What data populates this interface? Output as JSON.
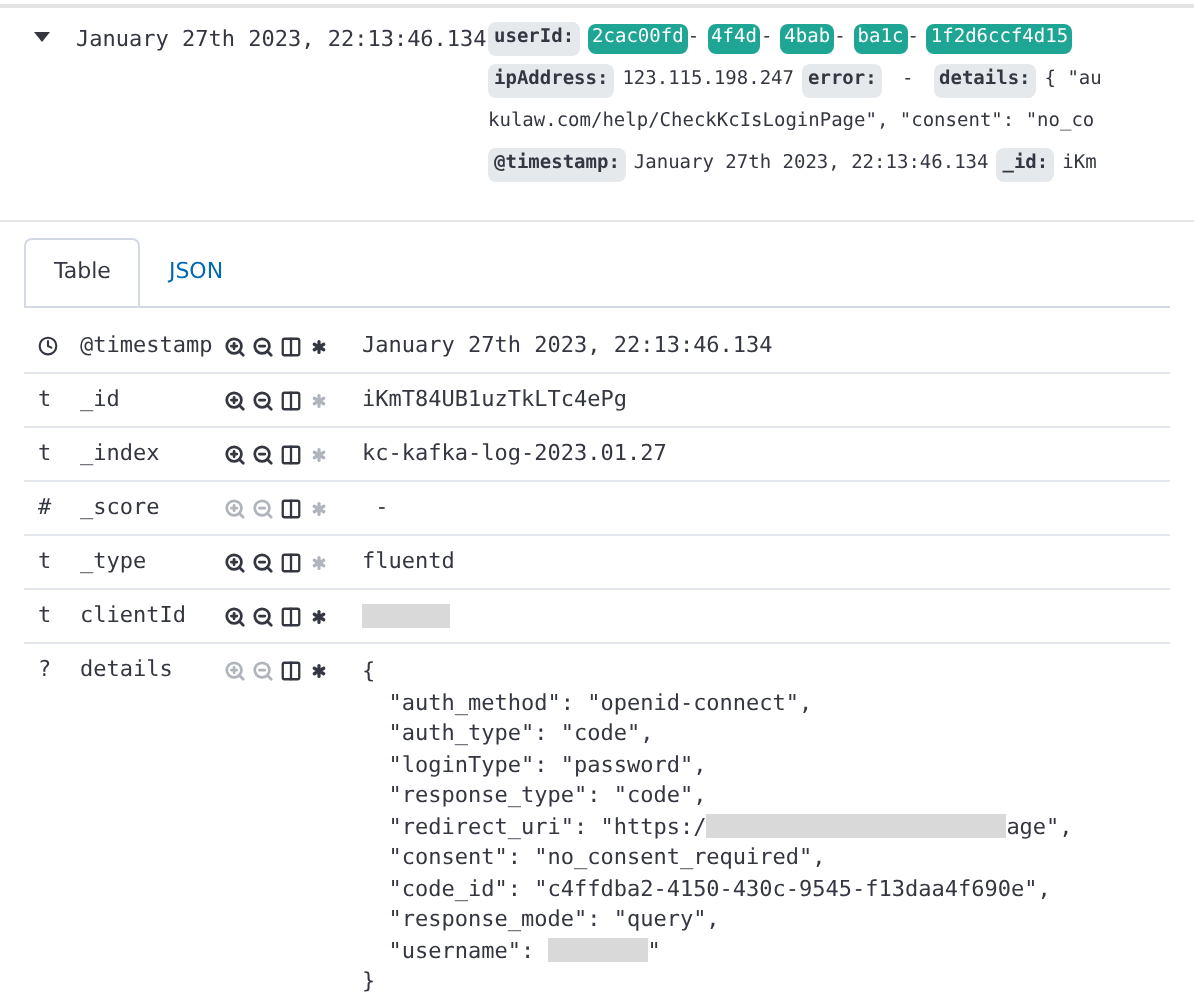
{
  "document": {
    "expanded": true,
    "timestamp": "January 27th 2023, 22:13:46.134",
    "summary_lines": [
      [
        {
          "kind": "key",
          "text": "userId:"
        },
        {
          "kind": "badge",
          "text": "2cac00fd"
        },
        {
          "kind": "value",
          "text": "-"
        },
        {
          "kind": "badge",
          "text": "4f4d"
        },
        {
          "kind": "value",
          "text": "-"
        },
        {
          "kind": "badge",
          "text": "4bab"
        },
        {
          "kind": "value",
          "text": "-"
        },
        {
          "kind": "badge",
          "text": "ba1c"
        },
        {
          "kind": "value",
          "text": "-"
        },
        {
          "kind": "badge",
          "text": "1f2d6ccf4d15"
        }
      ],
      [
        {
          "kind": "key",
          "text": "ipAddress:"
        },
        {
          "kind": "value",
          "text": "123.115.198.247"
        },
        {
          "kind": "key",
          "text": "error:"
        },
        {
          "kind": "value",
          "text": " - "
        },
        {
          "kind": "key",
          "text": "details:"
        },
        {
          "kind": "value",
          "text": "{ \"au"
        }
      ],
      [
        {
          "kind": "value",
          "text": "kulaw.com/help/CheckKcIsLoginPage\", \"consent\": \"no_co"
        }
      ],
      [
        {
          "kind": "key",
          "text": "@timestamp:"
        },
        {
          "kind": "value",
          "text": "January 27th 2023, 22:13:46.134"
        },
        {
          "kind": "key",
          "text": "_id:"
        },
        {
          "kind": "value",
          "text": "iKm"
        }
      ]
    ]
  },
  "tabs": [
    {
      "label": "Table",
      "selected": true
    },
    {
      "label": "JSON",
      "selected": false
    }
  ],
  "fields": [
    {
      "kind": "date",
      "name": "@timestamp",
      "filterable": true,
      "exists_active": true,
      "value": {
        "kind": "text",
        "text": "January 27th 2023, 22:13:46.134"
      }
    },
    {
      "kind": "string",
      "symbol": "t",
      "name": "_id",
      "filterable": true,
      "exists_active": false,
      "value": {
        "kind": "text",
        "text": "iKmT84UB1uzTkLTc4ePg"
      }
    },
    {
      "kind": "string",
      "symbol": "t",
      "name": "_index",
      "filterable": true,
      "exists_active": false,
      "value": {
        "kind": "text",
        "text": "kc-kafka-log-2023.01.27"
      }
    },
    {
      "kind": "number",
      "symbol": "#",
      "name": "_score",
      "filterable": false,
      "exists_active": false,
      "value": {
        "kind": "text",
        "text": " -"
      }
    },
    {
      "kind": "string",
      "symbol": "t",
      "name": "_type",
      "filterable": true,
      "exists_active": false,
      "value": {
        "kind": "text",
        "text": "fluentd"
      }
    },
    {
      "kind": "string",
      "symbol": "t",
      "name": "clientId",
      "filterable": true,
      "exists_active": true,
      "value": {
        "kind": "redacted"
      }
    },
    {
      "kind": "unknown",
      "symbol": "?",
      "name": "details",
      "filterable": false,
      "exists_active": true,
      "value": {
        "kind": "json",
        "lines": [
          {
            "text": "{"
          },
          {
            "text": "  \"auth_method\": \"openid-connect\","
          },
          {
            "text": "  \"auth_type\": \"code\","
          },
          {
            "text": "  \"loginType\": \"password\","
          },
          {
            "text": "  \"response_type\": \"code\","
          },
          {
            "text": "  \"redirect_uri\": \"https:/",
            "redacted": true,
            "after": "age\","
          },
          {
            "text": "  \"consent\": \"no_consent_required\","
          },
          {
            "text": "  \"code_id\": \"c4ffdba2-4150-430c-9545-f13daa4f690e\","
          },
          {
            "text": "  \"response_mode\": \"query\","
          },
          {
            "text": "  \"username\": ",
            "redacted": true,
            "after": "\""
          },
          {
            "text": "}"
          }
        ]
      }
    }
  ]
}
